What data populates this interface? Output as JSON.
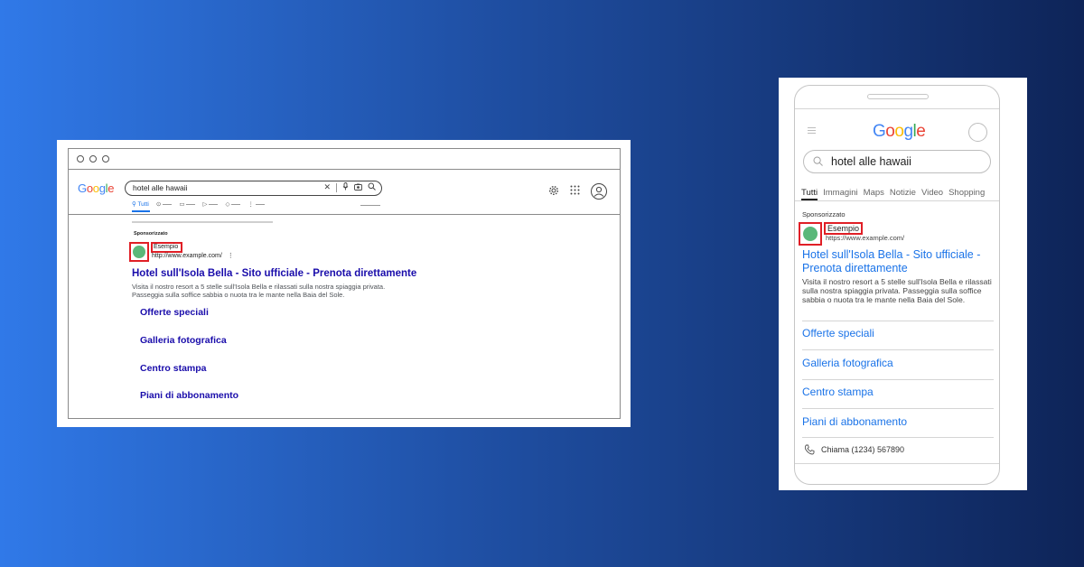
{
  "desktop": {
    "logo": "Google",
    "search_query": "hotel alle hawaii",
    "active_tab": "Tutti",
    "sponsored_label": "Sponsorizzato",
    "advertiser_name": "Esempio",
    "display_url": "http://www.example.com/",
    "ad_title": "Hotel sull'Isola Bella - Sito ufficiale - Prenota direttamente",
    "ad_description_line1": "Visita il nostro resort a 5 stelle sull'Isola Bella e rilassati sulla nostra spiaggia privata.",
    "ad_description_line2": "Passeggia sulla soffice sabbia o nuota tra le mante nella Baia del Sole.",
    "sitelinks": [
      "Offerte speciali",
      "Galleria fotografica",
      "Centro stampa",
      "Piani di abbonamento"
    ]
  },
  "mobile": {
    "logo": "Google",
    "search_query": "hotel alle hawaii",
    "tabs": [
      "Tutti",
      "Immagini",
      "Maps",
      "Notizie",
      "Video",
      "Shopping"
    ],
    "active_tab": "Tutti",
    "sponsored_label": "Sponsorizzato",
    "advertiser_name": "Esempio",
    "display_url": "https://www.example.com/",
    "ad_title": "Hotel sull'Isola Bella - Sito ufficiale - Prenota direttamente",
    "ad_description": "Visita il nostro resort a 5 stelle sull'Isola Bella e rilassati sulla nostra spiaggia privata. Passeggia sulla soffice sabbia o nuota tra le mante nella Baia del Sole.",
    "sitelinks": [
      "Offerte speciali",
      "Galleria fotografica",
      "Centro stampa",
      "Piani di abbonamento"
    ],
    "call_text": "Chiama (1234) 567890"
  },
  "colors": {
    "background_start": "#3079e8",
    "background_end": "#0e2458",
    "highlight_box": "#e01f26",
    "favicon": "#5ab879",
    "desktop_link": "#1a0dab",
    "mobile_link": "#1a73e8"
  }
}
